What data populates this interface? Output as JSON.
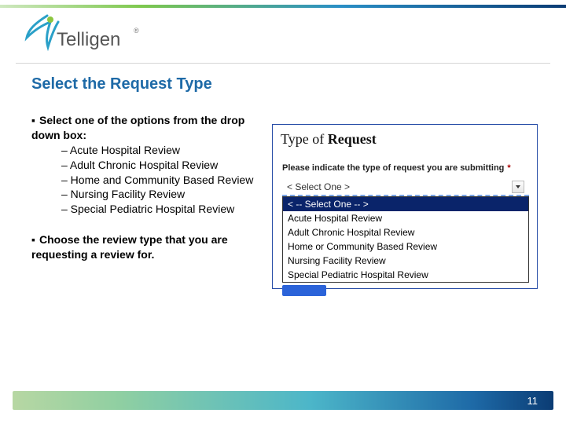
{
  "brand": {
    "name": "Telligen",
    "reg": "®"
  },
  "title": "Select the Request Type",
  "lead": {
    "bullet": "▪",
    "text": "Select one of the options from the drop down box:"
  },
  "options": [
    "– Acute Hospital Review",
    "– Adult Chronic Hospital Review",
    "– Home and Community Based Review",
    "– Nursing Facility Review",
    "– Special Pediatric Hospital Review"
  ],
  "lead2": {
    "bullet": "▪",
    "text": "Choose the review type that you are requesting a review for."
  },
  "screenshot": {
    "title_a": "Type of ",
    "title_b": "Request",
    "prompt": "Please indicate the type of request you are submitting",
    "star": "*",
    "selected_display": "<    Select One    >",
    "dropdown": [
      "< -- Select One -- >",
      "Acute Hospital Review",
      "Adult Chronic Hospital Review",
      "Home or Community Based Review",
      "Nursing Facility Review",
      "Special Pediatric Hospital Review"
    ]
  },
  "page_number": "11"
}
